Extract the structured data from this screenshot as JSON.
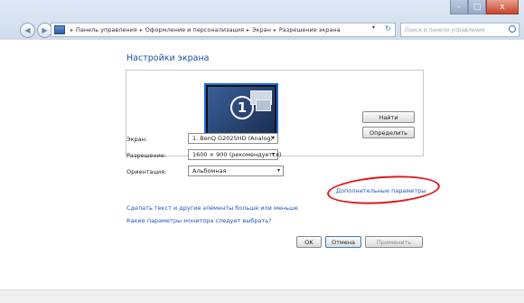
{
  "window": {
    "controls": {
      "minimize": "–",
      "maximize": "□",
      "close": "x"
    }
  },
  "nav": {
    "back": "◀",
    "forward": "▶"
  },
  "address": {
    "crumbs": [
      "Панель управления",
      "Оформление и персонализация",
      "Экран",
      "Разрешение экрана"
    ],
    "separator": "▸",
    "dropdown": "▾",
    "refresh": "↻"
  },
  "search": {
    "placeholder": "Поиск в панели управления"
  },
  "page": {
    "title": "Настройки экрана",
    "monitor_number": "1"
  },
  "buttons": {
    "find": "Найти",
    "identify": "Определить",
    "ok": "OK",
    "cancel": "Отмена",
    "apply": "Применить"
  },
  "form": {
    "display_label": "Экран:",
    "display_value": "1. BenQ G2025HD (Analog)",
    "resolution_label": "Разрешение:",
    "resolution_value": "1600 × 900 (рекомендуется)",
    "orientation_label": "Ориентация:",
    "orientation_value": "Альбомная"
  },
  "links": {
    "advanced": "Дополнительные параметры",
    "text_size": "Сделать текст и другие элементы больше или меньше",
    "which_settings": "Какие параметры монитора следует выбрать?"
  },
  "colors": {
    "link": "#1e57b8",
    "title": "#1e4ea0",
    "annotation": "#e01818"
  }
}
